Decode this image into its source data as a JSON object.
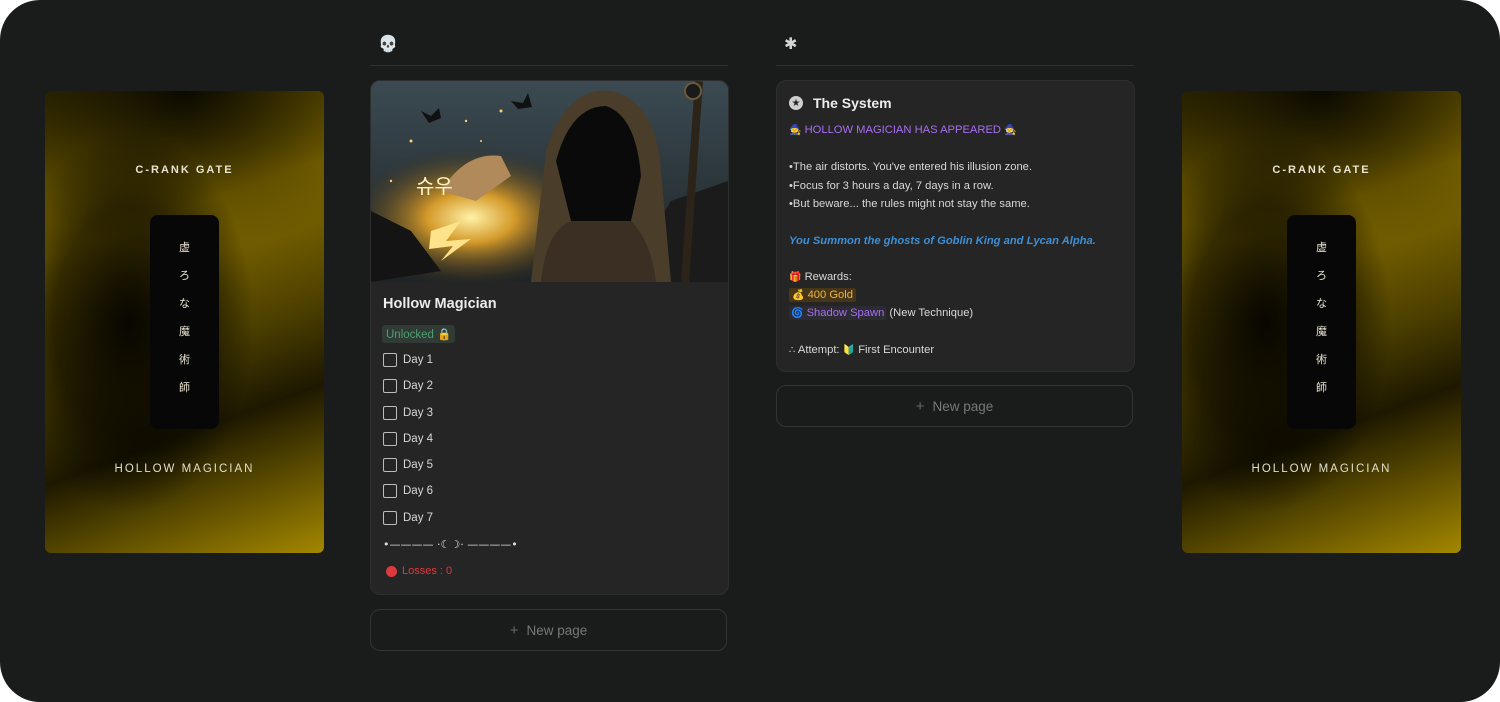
{
  "gates": {
    "rank": "C-RANK GATE",
    "chars": [
      "虚",
      "ろ",
      "な",
      "魔",
      "術",
      "師"
    ],
    "name": "HOLLOW MAGICIAN"
  },
  "columns": [
    {
      "icon": "skull-icon",
      "glyph": "💀"
    },
    {
      "icon": "asterisk-icon",
      "glyph": "✱"
    }
  ],
  "quest_card": {
    "title": "Hollow Magician",
    "image_text": "슈우",
    "status": "Unlocked 🔒",
    "days": [
      "Day 1",
      "Day 2",
      "Day 3",
      "Day 4",
      "Day 5",
      "Day 6",
      "Day 7"
    ],
    "divider": "•———— ·☾☽· ————•",
    "losses": "Losses : 0"
  },
  "system_card": {
    "title": "The System",
    "alert": "HOLLOW MAGICIAN HAS APPEARED",
    "lines": [
      "•The air distorts. You've entered his illusion zone.",
      "•Focus for 3 hours a day, 7 days in a row.",
      "•But beware... the rules might not stay the same."
    ],
    "summon": "You Summon the ghosts of Goblin King and Lycan Alpha.",
    "rewards_label": "Rewards:",
    "gold": "400 Gold",
    "technique": "Shadow Spawn",
    "technique_note": " (New Technique)",
    "attempt_label": "Attempt:",
    "attempt_value": "First Encounter"
  },
  "new_page_label": "New page",
  "colors": {
    "accent_gold": "#e9b44b",
    "purple": "#a86ff0",
    "blue": "#3d8fd6",
    "loss_red": "#e0393b",
    "unlocked_green": "#4aa071"
  }
}
